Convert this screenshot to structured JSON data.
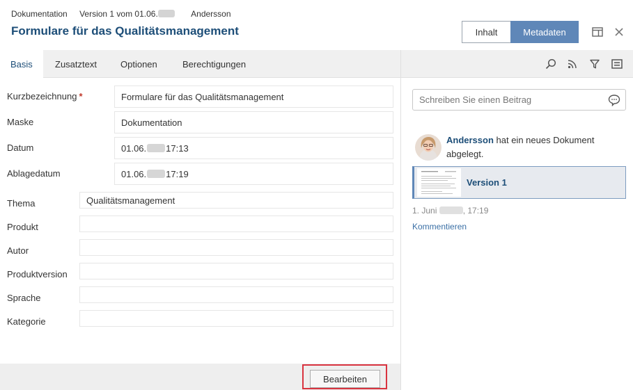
{
  "header": {
    "doc_type": "Dokumentation",
    "version_prefix": "Version 1 vom 01.06.",
    "author": "Andersson",
    "title": "Formulare für das Qualitätsmanagement",
    "view_inhalt": "Inhalt",
    "view_metadaten": "Metadaten"
  },
  "tabs": [
    "Basis",
    "Zusatztext",
    "Optionen",
    "Berechtigungen"
  ],
  "form": {
    "kurzbezeichnung": {
      "label": "Kurzbezeichnung",
      "required_mark": "*",
      "value": "Formulare für das Qualitätsmanagement"
    },
    "maske": {
      "label": "Maske",
      "value": "Dokumentation"
    },
    "datum": {
      "label": "Datum",
      "value_prefix": "01.06.",
      "value_time": "17:13"
    },
    "ablagedatum": {
      "label": "Ablagedatum",
      "value_prefix": "01.06.",
      "value_time": "17:19"
    },
    "thema": {
      "label": "Thema",
      "value": "Qualitätsmanagement"
    },
    "produkt": {
      "label": "Produkt",
      "value": ""
    },
    "autor": {
      "label": "Autor",
      "value": ""
    },
    "produktversion": {
      "label": "Produktversion",
      "value": ""
    },
    "sprache": {
      "label": "Sprache",
      "value": ""
    },
    "kategorie": {
      "label": "Kategorie",
      "value": ""
    }
  },
  "footer": {
    "edit_label": "Bearbeiten"
  },
  "feed": {
    "post_placeholder": "Schreiben Sie einen Beitrag",
    "activity_name": "Andersson",
    "activity_text": " hat ein neues Dokument abgelegt.",
    "doc_card_title": "Version 1",
    "timestamp_prefix": "1. Juni",
    "timestamp_time": ", 17:19",
    "comment_link": "Kommentieren"
  },
  "colors": {
    "accent": "#5f87b8",
    "title": "#1d4e78",
    "required": "#c0392b",
    "highlight": "#d9333f"
  }
}
